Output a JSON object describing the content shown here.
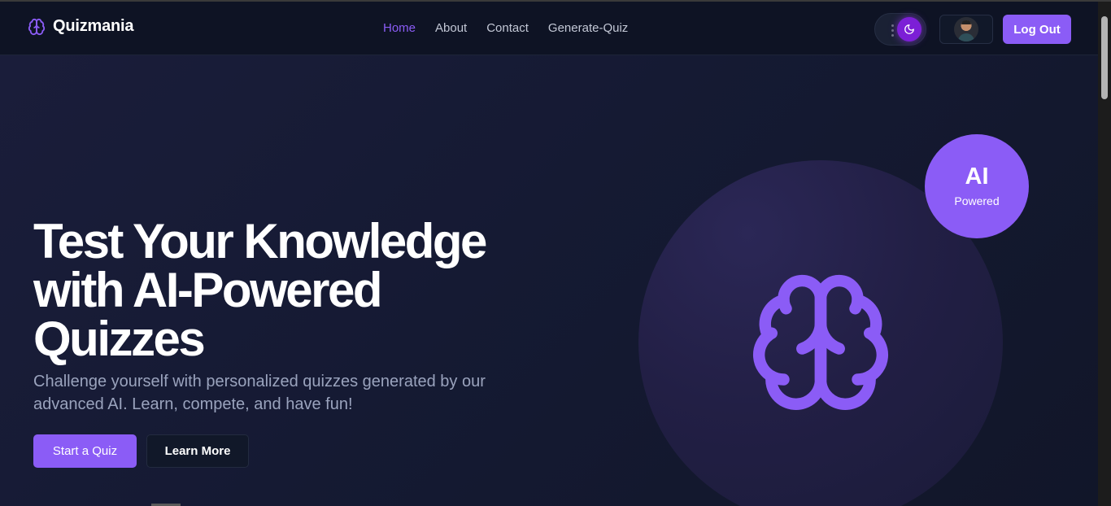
{
  "brand": {
    "name": "Quizmania",
    "icon": "brain-icon",
    "accent": "#8b5cf6"
  },
  "nav": {
    "links": [
      {
        "label": "Home",
        "active": true
      },
      {
        "label": "About",
        "active": false
      },
      {
        "label": "Contact",
        "active": false
      },
      {
        "label": "Generate-Quiz",
        "active": false
      }
    ],
    "theme_toggle_icon": "moon-icon",
    "logout_label": "Log Out"
  },
  "hero": {
    "title": "Test Your Knowledge with AI-Powered Quizzes",
    "subtitle": "Challenge yourself with personalized quizzes generated by our advanced AI. Learn, compete, and have fun!",
    "primary_button": "Start a Quiz",
    "secondary_button": "Learn More",
    "badge_main": "AI",
    "badge_sub": "Powered",
    "illustration_icon": "brain-icon"
  },
  "colors": {
    "background": "#0f1427",
    "nav_background": "#0e1324",
    "primary": "#8b5cf6",
    "toggle_knob": "#7c1fd6"
  }
}
